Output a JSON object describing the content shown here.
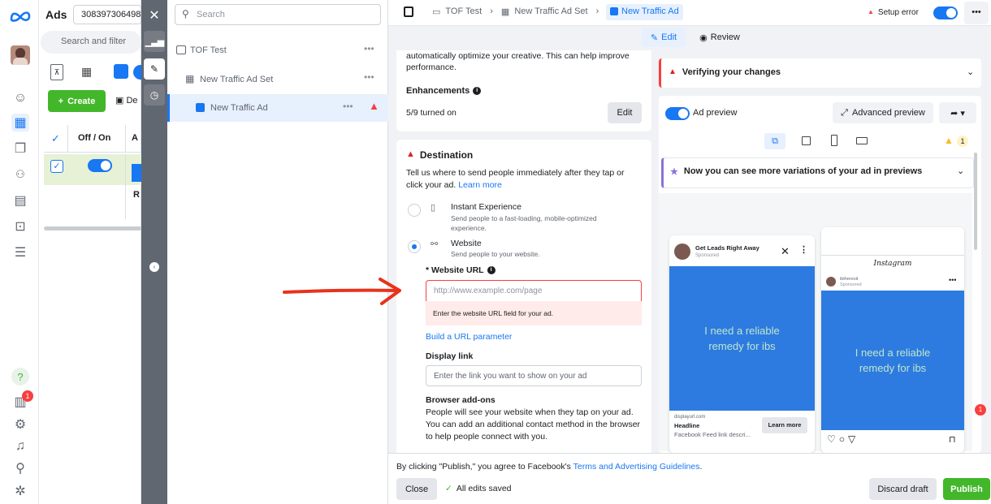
{
  "rail": {
    "logo": "meta-logo",
    "notification_count": "1"
  },
  "leftcol": {
    "title": "Ads",
    "account_id": "308397306498",
    "search_placeholder": "Search and filter",
    "create_label": "Create",
    "de_label": "De",
    "col_offon": "Off / On",
    "col_a": "A",
    "r_label": "R"
  },
  "tree": {
    "search_placeholder": "Search",
    "items": [
      {
        "label": "TOF Test"
      },
      {
        "label": "New Traffic Ad Set"
      },
      {
        "label": "New Traffic Ad"
      }
    ]
  },
  "topbar": {
    "breadcrumb": [
      "TOF Test",
      "New Traffic Ad Set",
      "New Traffic Ad"
    ],
    "setup_error": "Setup error",
    "edit_tab": "Edit",
    "review_tab": "Review"
  },
  "form": {
    "top_text": "automatically optimize your creative. This can help improve performance.",
    "enhancements_title": "Enhancements",
    "enhancements_status": "5/9 turned on",
    "enhancements_edit": "Edit",
    "destination_title": "Destination",
    "destination_desc": "Tell us where to send people immediately after they tap or click your ad.",
    "learn_more": "Learn more",
    "options": [
      {
        "title": "Instant Experience",
        "desc": "Send people to a fast-loading, mobile-optimized experience.",
        "selected": false
      },
      {
        "title": "Website",
        "desc": "Send people to your website.",
        "selected": true
      }
    ],
    "url_label": "* Website URL",
    "url_placeholder": "http://www.example.com/page",
    "url_error": "Enter the website URL field for your ad.",
    "build_url": "Build a URL parameter",
    "display_link_label": "Display link",
    "display_link_placeholder": "Enter the link you want to show on your ad",
    "browser_addons_title": "Browser add-ons",
    "browser_addons_desc": "People will see your website when they tap on your ad. You can add an additional contact method in the browser to help people connect with you."
  },
  "preview": {
    "verifying": "Verifying your changes",
    "ad_preview": "Ad preview",
    "advanced_preview": "Advanced preview",
    "warning_count": "1",
    "variations_banner": "Now you can see more variations of your ad in previews",
    "fb_card": {
      "page_name": "Get Leads Right Away",
      "sponsored": "Sponsored",
      "creative_text": "I need a reliable remedy for ibs",
      "domain": "displayurl.com",
      "headline": "Headline",
      "description": "Facebook Feed link descri...",
      "cta": "Learn more"
    },
    "ig_card": {
      "app_name": "Instagram",
      "account": "ibtheresit",
      "sponsored": "Sponsored",
      "creative_text": "I need a reliable remedy for ibs"
    },
    "badge_count": "1"
  },
  "footer": {
    "agreement_prefix": "By clicking \"Publish,\" you agree to Facebook's",
    "agreement_link": "Terms and Advertising Guidelines",
    "agreement_suffix": ".",
    "close": "Close",
    "saved": "All edits saved",
    "discard": "Discard draft",
    "publish": "Publish"
  },
  "colors": {
    "accent": "#1877f2",
    "publish": "#42b72a",
    "error": "#fa3e3e",
    "error_bg": "#ffebe9",
    "creative_blue": "#2d7be0",
    "creative_text": "#bfe6cc",
    "arrow": "#e8321c"
  }
}
